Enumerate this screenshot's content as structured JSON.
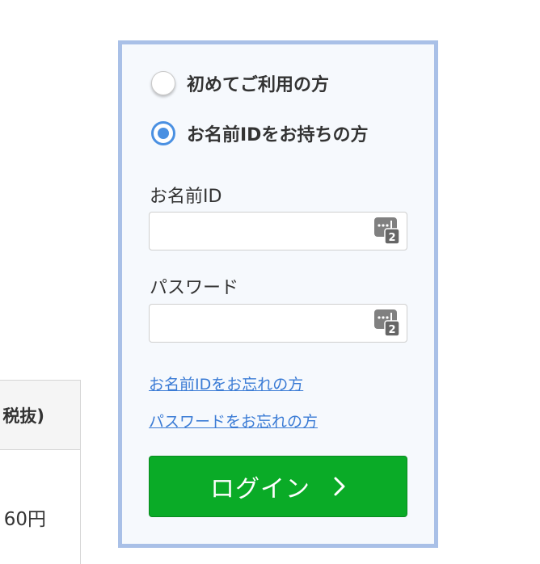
{
  "background_table": {
    "header_text": "税抜)",
    "cell_text": "60円"
  },
  "login": {
    "radio_options": [
      {
        "label": "初めてご利用の方",
        "checked": false
      },
      {
        "label": "お名前IDをお持ちの方",
        "checked": true
      }
    ],
    "id_label": "お名前ID",
    "id_value": "",
    "password_label": "パスワード",
    "password_value": "",
    "password_manager_icon": "password-manager-icon",
    "forgot_id_link": "お名前IDをお忘れの方",
    "forgot_password_link": "パスワードをお忘れの方",
    "submit_label": "ログイン",
    "submit_icon": "chevron-right-icon"
  },
  "colors": {
    "panel_border": "#a9c0e7",
    "panel_background": "#f6f9fd",
    "radio_accent": "#4a90e2",
    "link": "#3a7bd5",
    "button": "#0aab27"
  }
}
